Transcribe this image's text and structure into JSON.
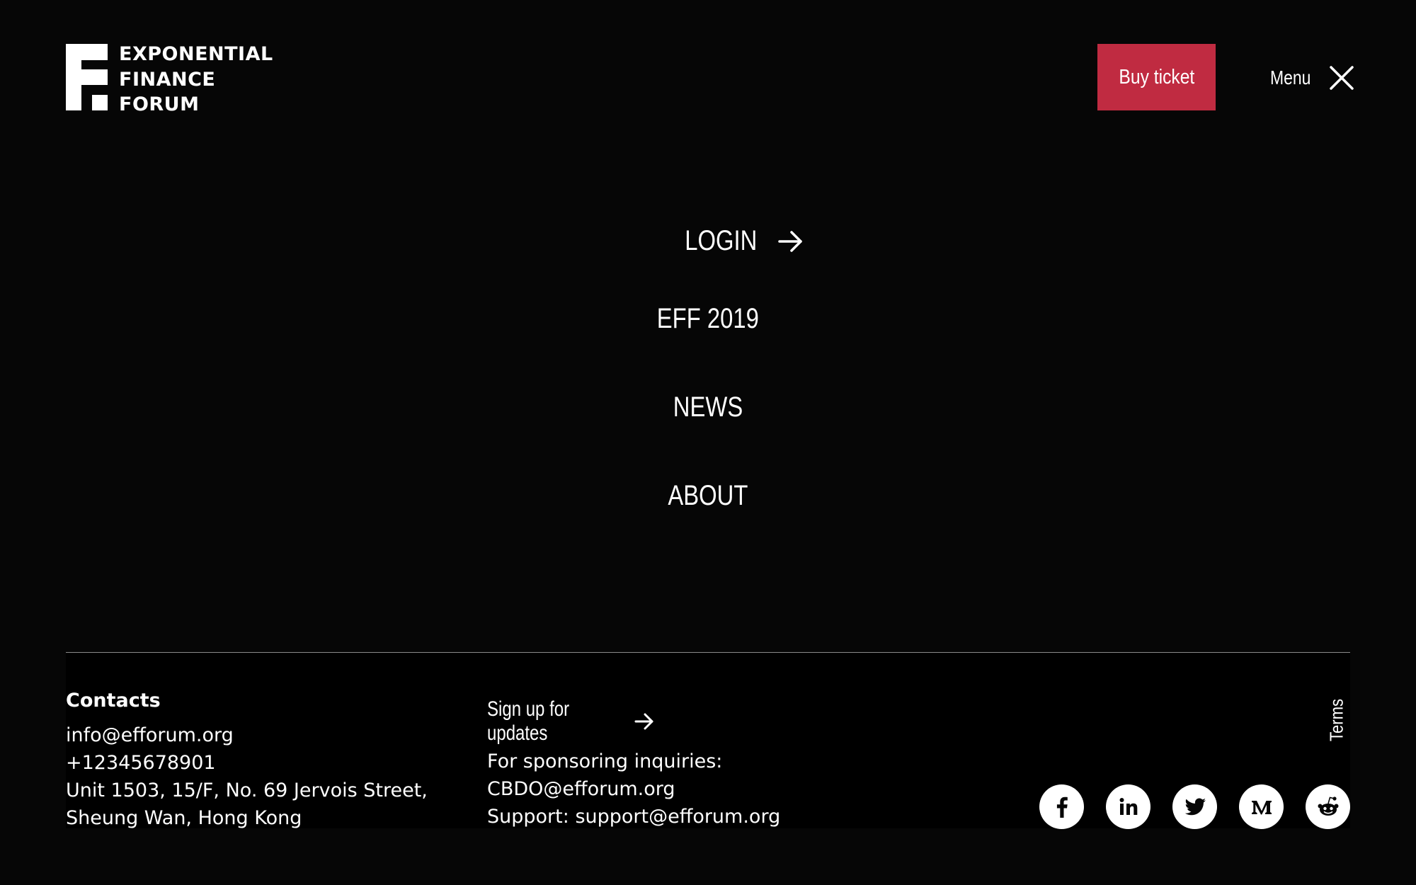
{
  "header": {
    "logo_lines": [
      "EXPONENTIAL",
      "FINANCE",
      "FORUM"
    ],
    "buy_ticket_label": "Buy ticket",
    "menu_label": "Menu"
  },
  "nav": {
    "items": [
      {
        "label": "LOGIN",
        "icon": "arrow-right-icon"
      },
      {
        "label": "EFF 2019"
      },
      {
        "label": "NEWS"
      },
      {
        "label": "ABOUT"
      }
    ]
  },
  "footer": {
    "contacts": {
      "title": "Contacts",
      "email": "info@efforum.org",
      "phone": "+12345678901",
      "address_line1": "Unit 1503, 15/F, No. 69 Jervois Street,",
      "address_line2": "Sheung Wan, Hong Kong"
    },
    "signup_label": "Sign up for updates",
    "sponsor_text": "For sponsoring inquiries:",
    "sponsor_email": "CBDO@efforum.org",
    "support_prefix": "Support:",
    "support_email": "support@efforum.org",
    "terms_label": "Terms",
    "socials": [
      "facebook-icon",
      "linkedin-icon",
      "twitter-icon",
      "medium-icon",
      "reddit-icon"
    ]
  },
  "colors": {
    "background": "#060606",
    "accent": "#c02b41",
    "text": "#ffffff",
    "divider": "#8a8a8a"
  }
}
